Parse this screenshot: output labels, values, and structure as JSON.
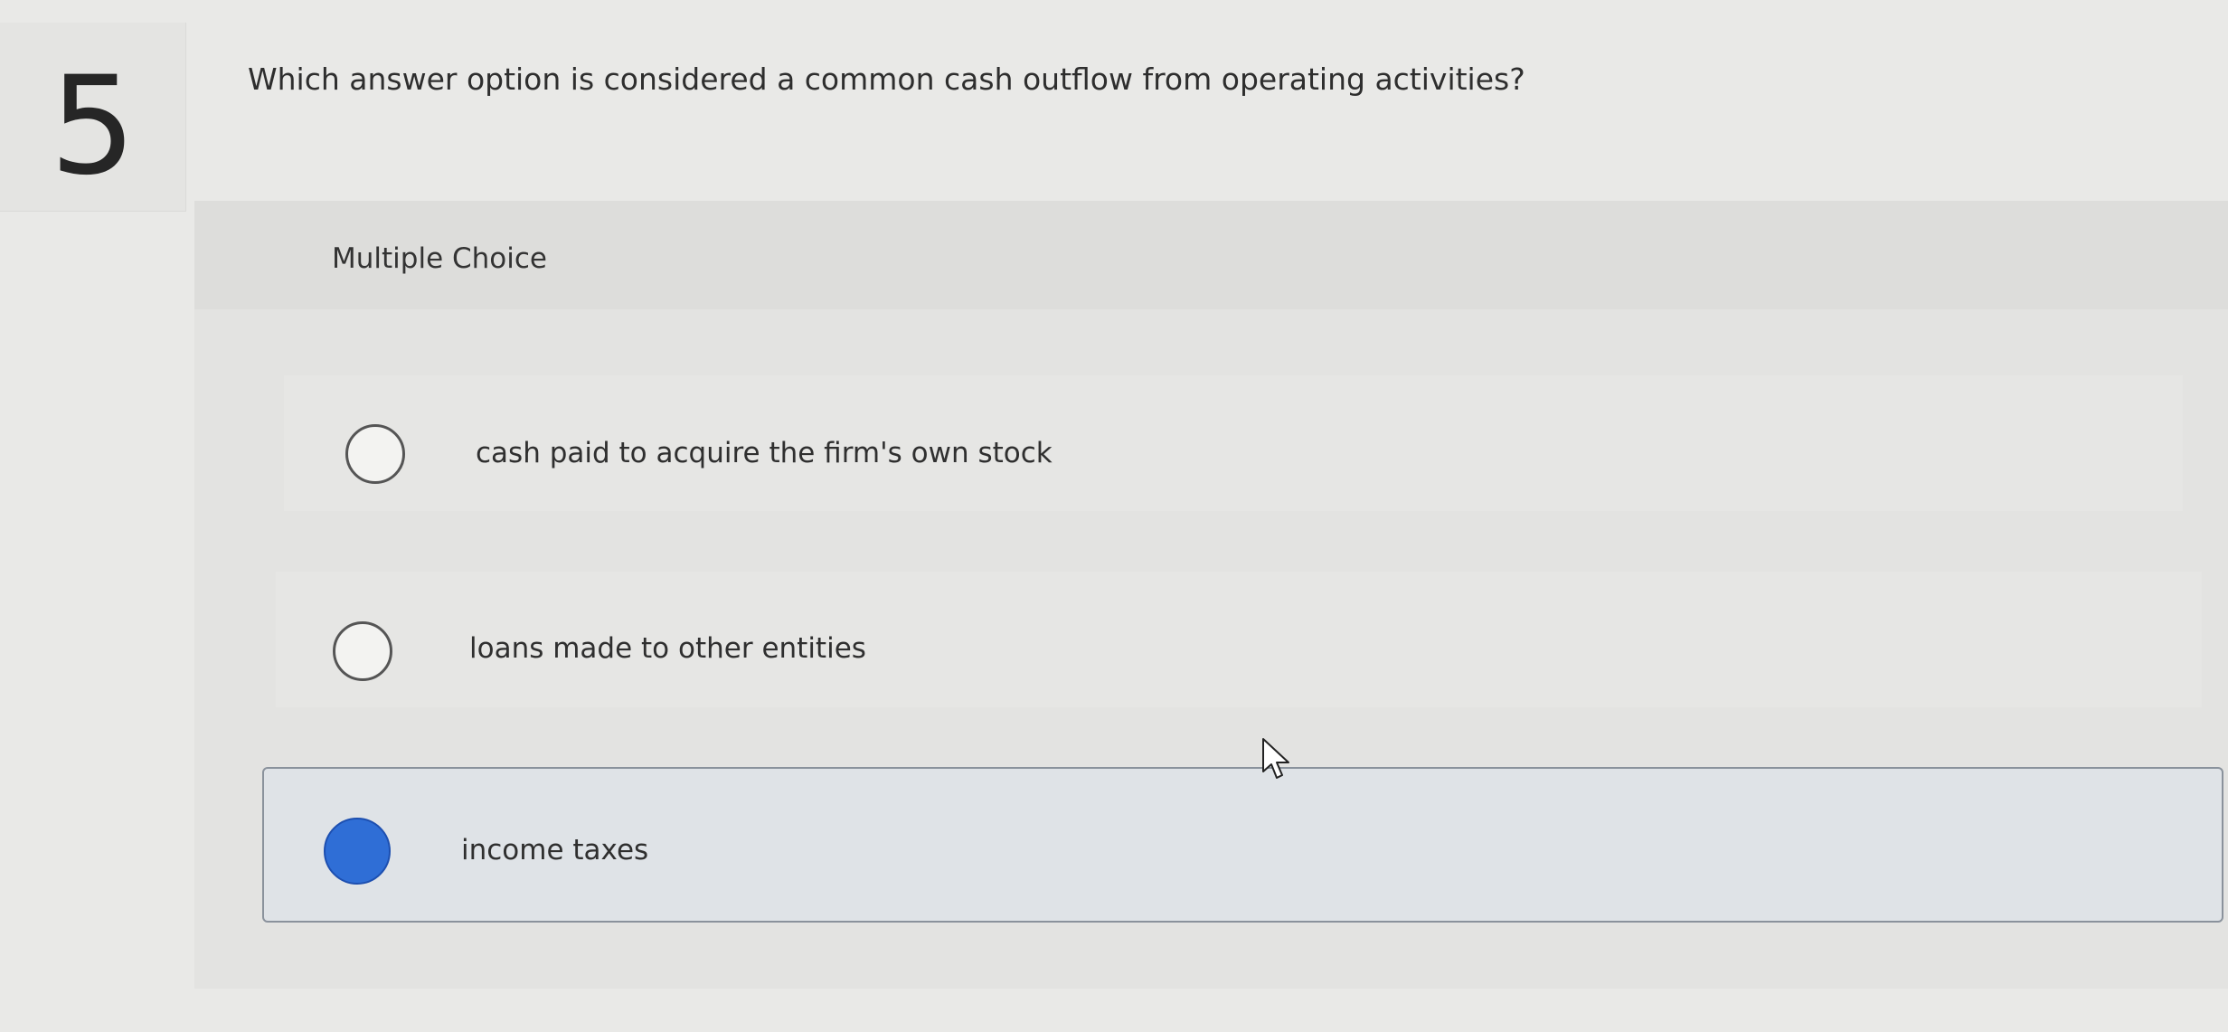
{
  "question": {
    "number": "5",
    "text": "Which answer option is considered a common cash outflow from operating activities?"
  },
  "section": {
    "label": "Multiple Choice"
  },
  "options": [
    {
      "label": "cash paid to acquire the firm's own stock",
      "selected": false
    },
    {
      "label": "loans made to other entities",
      "selected": false
    },
    {
      "label": "income taxes",
      "selected": true
    }
  ],
  "colors": {
    "selected_radio": "#2f6ed6",
    "selected_border": "#8a929c",
    "background": "#e9e9e7"
  },
  "icons": {
    "cursor": "mouse-pointer-icon",
    "radio_empty": "radio-unchecked-icon",
    "radio_filled": "radio-checked-icon"
  }
}
